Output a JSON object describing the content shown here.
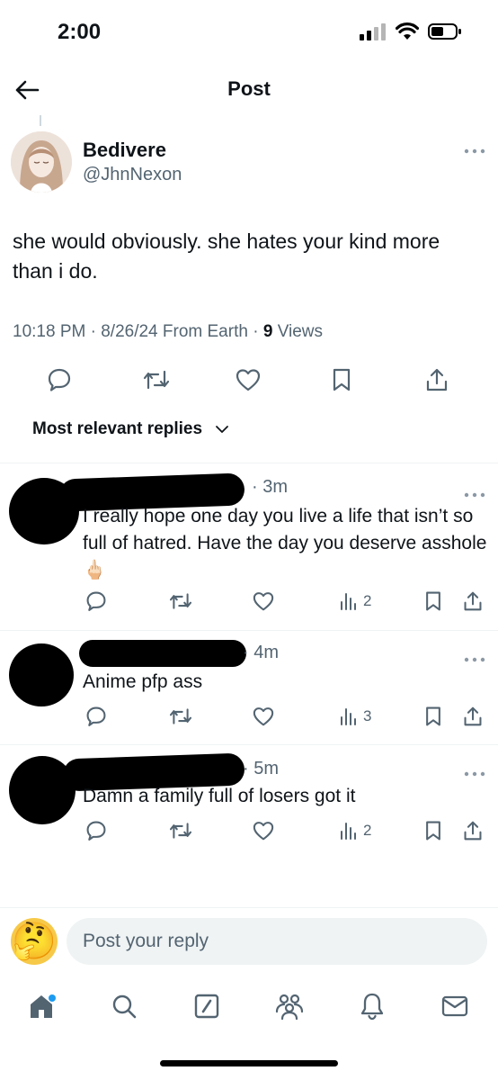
{
  "status_bar": {
    "time": "2:00"
  },
  "header": {
    "title": "Post"
  },
  "post": {
    "author_name": "Bedivere",
    "author_handle": "@JhnNexon",
    "text": "she would obviously. she hates your kind more than i do.",
    "time": "10:18 PM",
    "date": "8/26/24",
    "source": "From Earth",
    "views_count": "9",
    "views_label": "Views"
  },
  "sort": {
    "label": "Most relevant replies"
  },
  "replies": [
    {
      "time": "3m",
      "text": "I really hope one day you live a life that isn’t so full of hatred. Have the day you deserve asshole 🖕🏻",
      "views": "2"
    },
    {
      "time": "4m",
      "text": "Anime pfp ass",
      "views": "3"
    },
    {
      "time": "5m",
      "text": "Damn a family full of losers got it",
      "views": "2"
    }
  ],
  "reply_bar": {
    "placeholder": "Post your reply",
    "avatar_emoji": "🤔"
  },
  "colors": {
    "text": "#0f1419",
    "secondary": "#536471",
    "accent": "#1d9bf0",
    "divider": "#eff3f4"
  }
}
